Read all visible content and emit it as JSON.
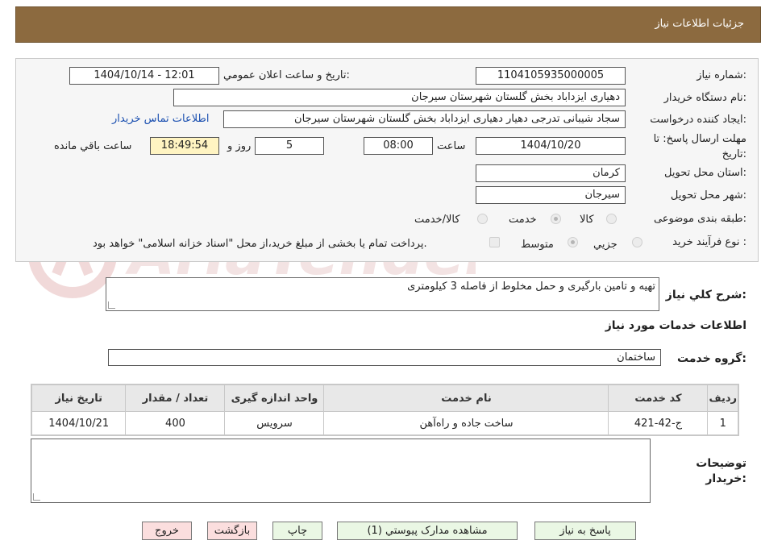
{
  "header": {
    "title": "جزئیات اطلاعات نیاز"
  },
  "form": {
    "need_number": {
      "label": "شماره نیاز:",
      "value": "1104105935000005"
    },
    "announce_datetime": {
      "label": "تاریخ و ساعت اعلان عمومي:",
      "value": "1404/10/14 - 12:01"
    },
    "buyer_org": {
      "label": "نام دستگاه خریدار:",
      "value": "دهیاری ایزداباد بخش گلستان شهرستان سیرجان"
    },
    "requester": {
      "label": "ایجاد کننده درخواست:",
      "value": "سجاد شیبانی تدرجی دهیار دهیاری ایزداباد بخش گلستان شهرستان سیرجان"
    },
    "contact_link": "اطلاعات تماس خریدار",
    "deadline": {
      "label_line1": "مهلت ارسال پاسخ: تا",
      "label_line2": "تاریخ:",
      "date": "1404/10/20",
      "time_label": "ساعت",
      "time": "08:00",
      "days": "5",
      "days_label": "روز و",
      "remaining_time": "18:49:54",
      "remaining_label": "ساعت باقي مانده"
    },
    "province": {
      "label": "استان محل تحویل:",
      "value": "کرمان"
    },
    "city": {
      "label": "شهر محل تحویل:",
      "value": "سیرجان"
    },
    "category": {
      "label": "طبقه بندی موضوعی:",
      "options": [
        "کالا",
        "خدمت",
        "کالا/خدمت"
      ],
      "selected": "خدمت"
    },
    "purchase_process": {
      "label": "نوع فرآیند خرید :",
      "options": [
        "جزیي",
        "متوسط"
      ],
      "selected": "متوسط",
      "payment_note": "پرداخت تمام یا بخشی از مبلغ خرید،از محل \"اسناد خزانه اسلامی\" خواهد بود."
    }
  },
  "description": {
    "label": "شرح کلي نیاز:",
    "value": "تهیه و تامین بارگیری و حمل مخلوط از فاصله 3 کیلومتری"
  },
  "services_section": {
    "title": "اطلاعات خدمات مورد نیاز",
    "group_label": "گروه خدمت:",
    "group_value": "ساختمان"
  },
  "table": {
    "headers": [
      "ردیف",
      "کد خدمت",
      "نام خدمت",
      "واحد اندازه گیری",
      "تعداد / مقدار",
      "تاریخ نیاز"
    ],
    "rows": [
      [
        "1",
        "ج-42-421",
        "ساخت جاده و راه‌آهن",
        "سرویس",
        "400",
        "1404/10/21"
      ]
    ]
  },
  "buyer_notes": {
    "label_line1": "توضیحات",
    "label_line2": "خریدار:"
  },
  "buttons": {
    "reply": "پاسخ به نیاز",
    "attachments": "مشاهده مدارک پیوستي (1)",
    "print": "چاپ",
    "back": "بازگشت",
    "exit": "خروج"
  },
  "colors": {
    "header_bg": "#8c6a3f",
    "button_green": "#eaf7e4",
    "button_pink": "#fbdede",
    "remaining_bg": "#fff4c2"
  }
}
